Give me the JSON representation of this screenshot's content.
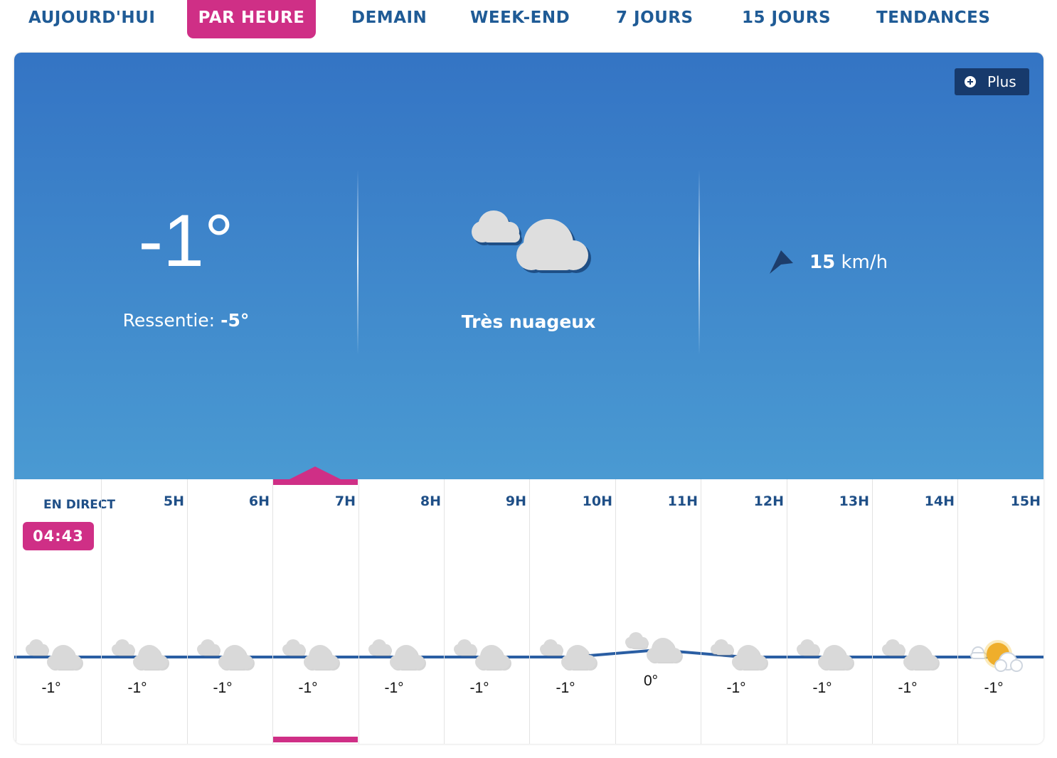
{
  "tabs": [
    {
      "label": "AUJOURD'HUI",
      "active": false
    },
    {
      "label": "PAR HEURE",
      "active": true
    },
    {
      "label": "DEMAIN",
      "active": false
    },
    {
      "label": "WEEK-END",
      "active": false
    },
    {
      "label": "7 JOURS",
      "active": false
    },
    {
      "label": "15 JOURS",
      "active": false
    },
    {
      "label": "TENDANCES",
      "active": false
    }
  ],
  "current": {
    "temperature": "-1°",
    "feels_label": "Ressentie:",
    "feels_value": "-5°",
    "condition": "Très nuageux",
    "condition_icon": "cloudy-icon",
    "wind_value": "15",
    "wind_unit": "km/h",
    "wind_icon": "wind-direction-arrow-icon"
  },
  "plus_button": {
    "label": "Plus",
    "icon": "plus-circle-icon"
  },
  "hourly": {
    "live_label": "EN DIRECT",
    "current_time": "04:43",
    "hours": [
      "5H",
      "6H",
      "7H",
      "8H",
      "9H",
      "10H",
      "11H",
      "12H",
      "13H",
      "14H",
      "15H"
    ],
    "selected_hour": "7H",
    "temperatures": [
      "-1°",
      "-1°",
      "-1°",
      "-1°",
      "-1°",
      "-1°",
      "-1°",
      "0°",
      "-1°",
      "-1°",
      "-1°",
      "-1°"
    ],
    "temperature_values": [
      -1,
      -1,
      -1,
      -1,
      -1,
      -1,
      -1,
      0,
      -1,
      -1,
      -1,
      -1
    ],
    "icons": [
      "cloudy-icon",
      "cloudy-icon",
      "cloudy-icon",
      "cloudy-icon",
      "cloudy-icon",
      "cloudy-icon",
      "cloudy-icon",
      "cloudy-icon",
      "cloudy-icon",
      "cloudy-icon",
      "cloudy-icon",
      "partly-sunny-icon"
    ]
  },
  "colors": {
    "accent": "#cf2f86",
    "navy": "#1f5b96",
    "sky_top": "#3474c4",
    "sky_bottom": "#4a9ad2",
    "trend_line": "#2a5ea3"
  }
}
